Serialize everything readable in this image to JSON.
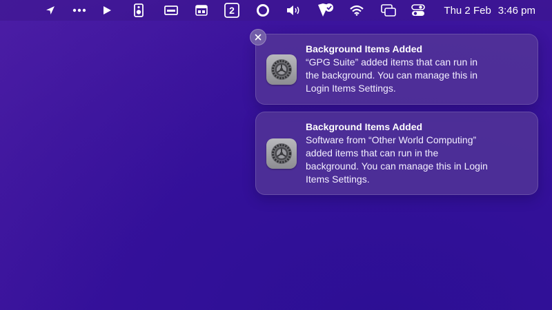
{
  "menubar": {
    "icons": [
      {
        "name": "location-arrow-icon"
      },
      {
        "name": "more-dots-icon"
      },
      {
        "name": "play-icon"
      },
      {
        "name": "speaker-device-icon"
      },
      {
        "name": "window-bar-icon"
      },
      {
        "name": "calendar-widget-icon"
      },
      {
        "name": "workspace-number-icon",
        "label": "2"
      },
      {
        "name": "circle-record-icon"
      },
      {
        "name": "volume-icon"
      },
      {
        "name": "vpn-shield-check-icon"
      },
      {
        "name": "wifi-icon"
      },
      {
        "name": "screen-mirroring-icon"
      },
      {
        "name": "control-center-icon"
      }
    ],
    "date": "Thu 2 Feb",
    "time": "3:46 pm"
  },
  "notifications": [
    {
      "app_icon": "system-settings-gear-icon",
      "title": "Background Items Added",
      "lines": [
        "“GPG Suite” added items that can run in",
        "the background. You can manage this in",
        "Login Items Settings."
      ]
    },
    {
      "app_icon": "system-settings-gear-icon",
      "title": "Background Items Added",
      "lines": [
        "Software from “Other World Computing”",
        "added items that can run in the",
        "background. You can manage this in Login",
        "Items Settings."
      ]
    }
  ],
  "close_button_icon": "close-icon",
  "colors": {
    "wallpaper": "#3a139c",
    "notification_bg": "#5c4096",
    "text": "#ffffff"
  }
}
